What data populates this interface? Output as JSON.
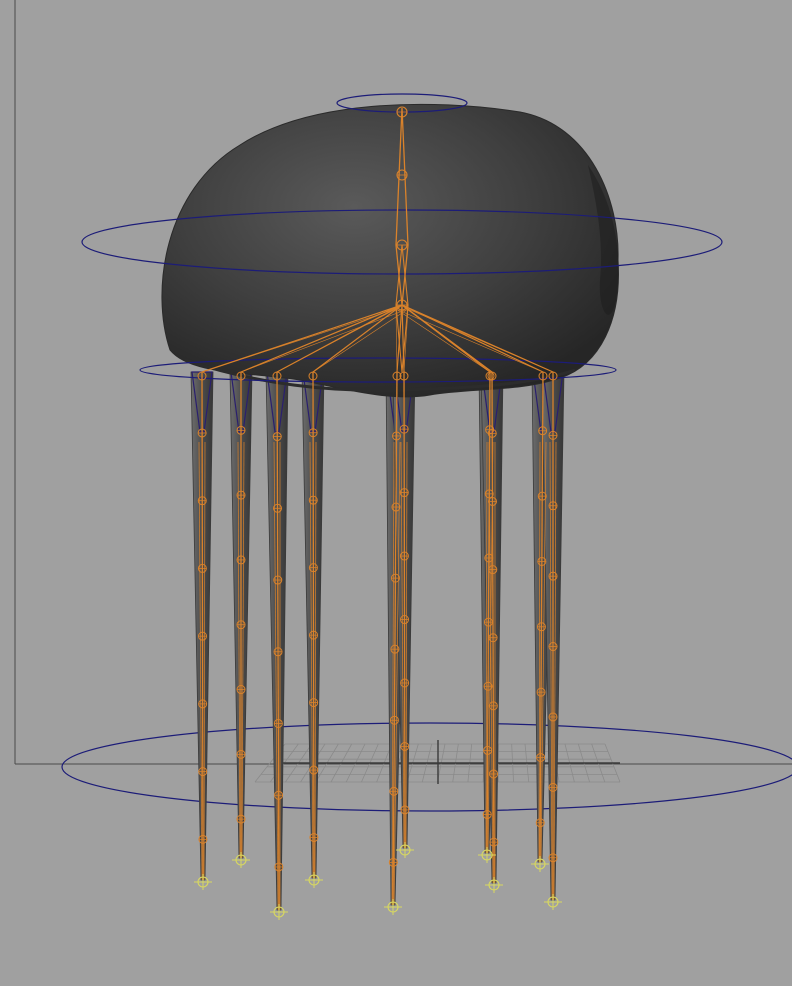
{
  "viewport": {
    "background": "#a0a0a0",
    "body_color": "#3e3e3e",
    "leg_color": "#5f5f5f",
    "joint_color": "#d9822b",
    "control_curve_color": "#1c1c78",
    "locator_color": "#d8d860",
    "grid_color": "#8a8a8a"
  },
  "scene": {
    "leg_count": 10
  }
}
